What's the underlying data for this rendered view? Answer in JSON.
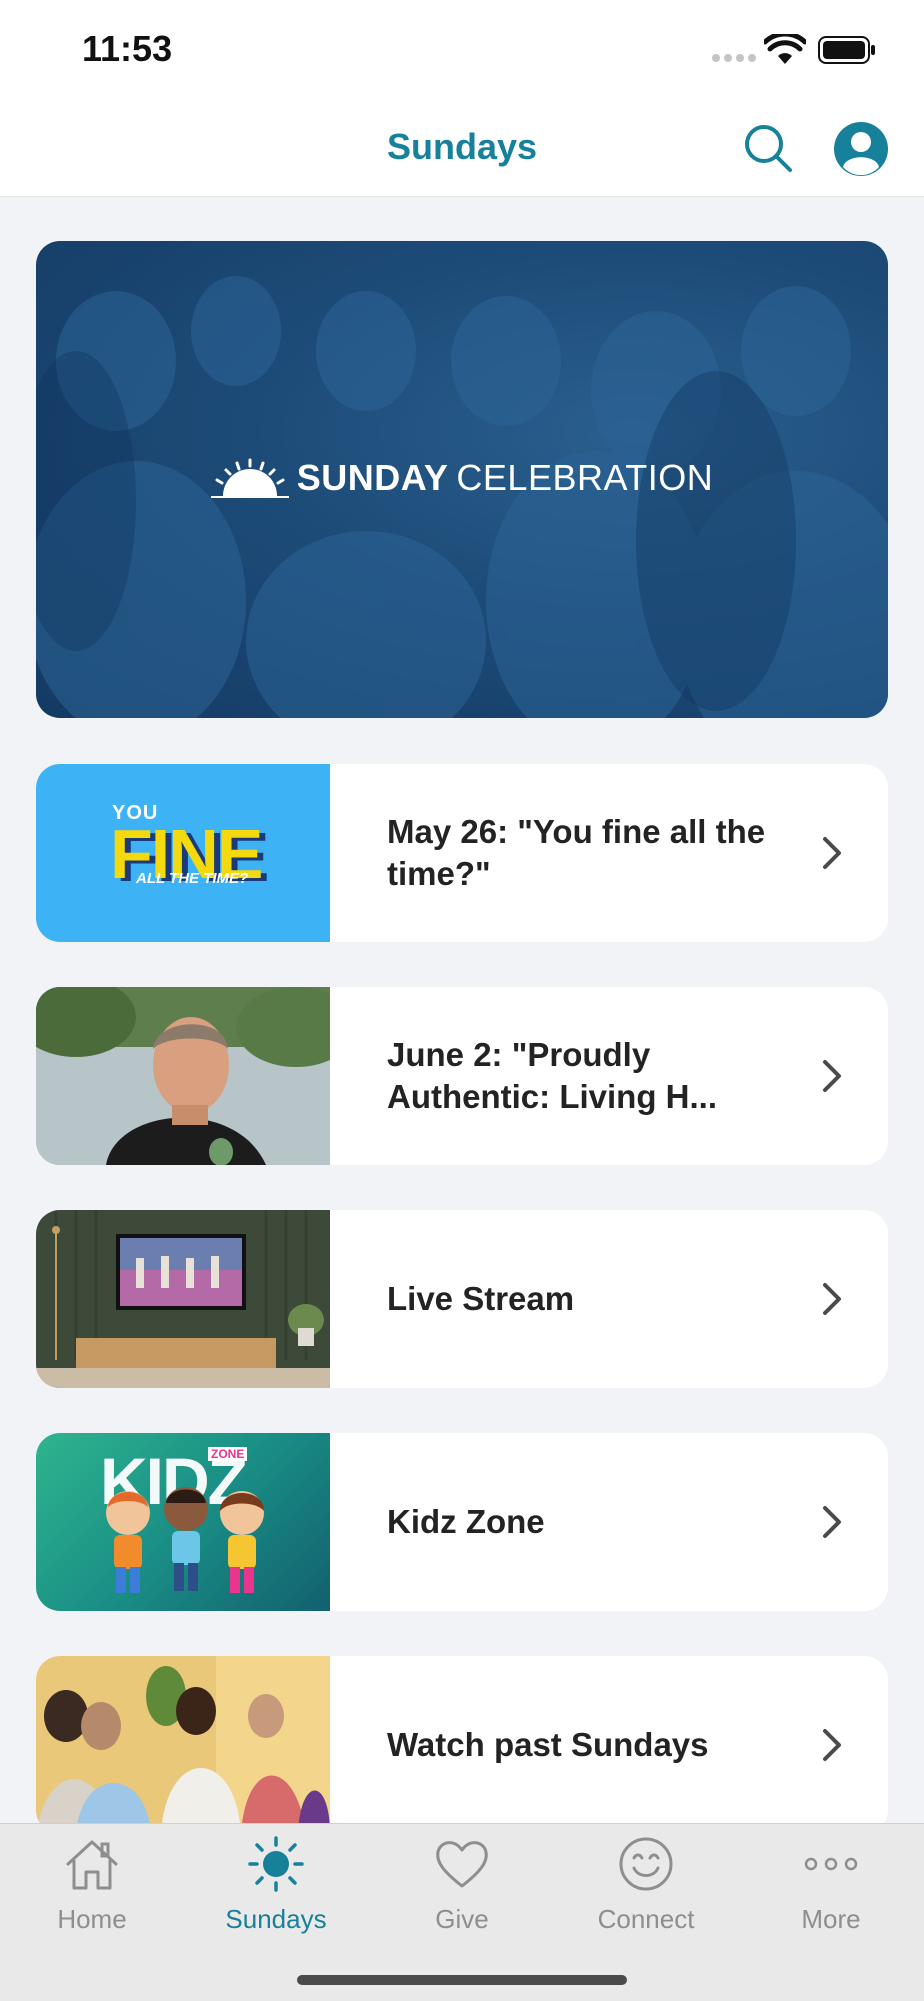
{
  "status_bar": {
    "time": "11:53"
  },
  "header": {
    "title": "Sundays"
  },
  "hero": {
    "title_bold": "SUNDAY",
    "title_light": "CELEBRATION"
  },
  "items": [
    {
      "label": "May 26: \"You fine all the time?\"",
      "thumb_text_top": "YOU",
      "thumb_text_main": "FINE",
      "thumb_text_bottom": "ALL THE TIME?"
    },
    {
      "label": "June 2: \"Proudly Authentic: Living H..."
    },
    {
      "label": "Live Stream"
    },
    {
      "label": "Kidz Zone",
      "thumb_text_main": "KIDZ",
      "thumb_text_badge": "ZONE"
    },
    {
      "label": "Watch past Sundays"
    }
  ],
  "tabs": [
    {
      "label": "Home",
      "icon": "home-icon"
    },
    {
      "label": "Sundays",
      "icon": "sun-icon",
      "active": true
    },
    {
      "label": "Give",
      "icon": "heart-icon"
    },
    {
      "label": "Connect",
      "icon": "smile-icon"
    },
    {
      "label": "More",
      "icon": "more-icon"
    }
  ],
  "colors": {
    "accent": "#17809a",
    "hero_bg": "#1d4b78",
    "background": "#f2f3f7"
  }
}
